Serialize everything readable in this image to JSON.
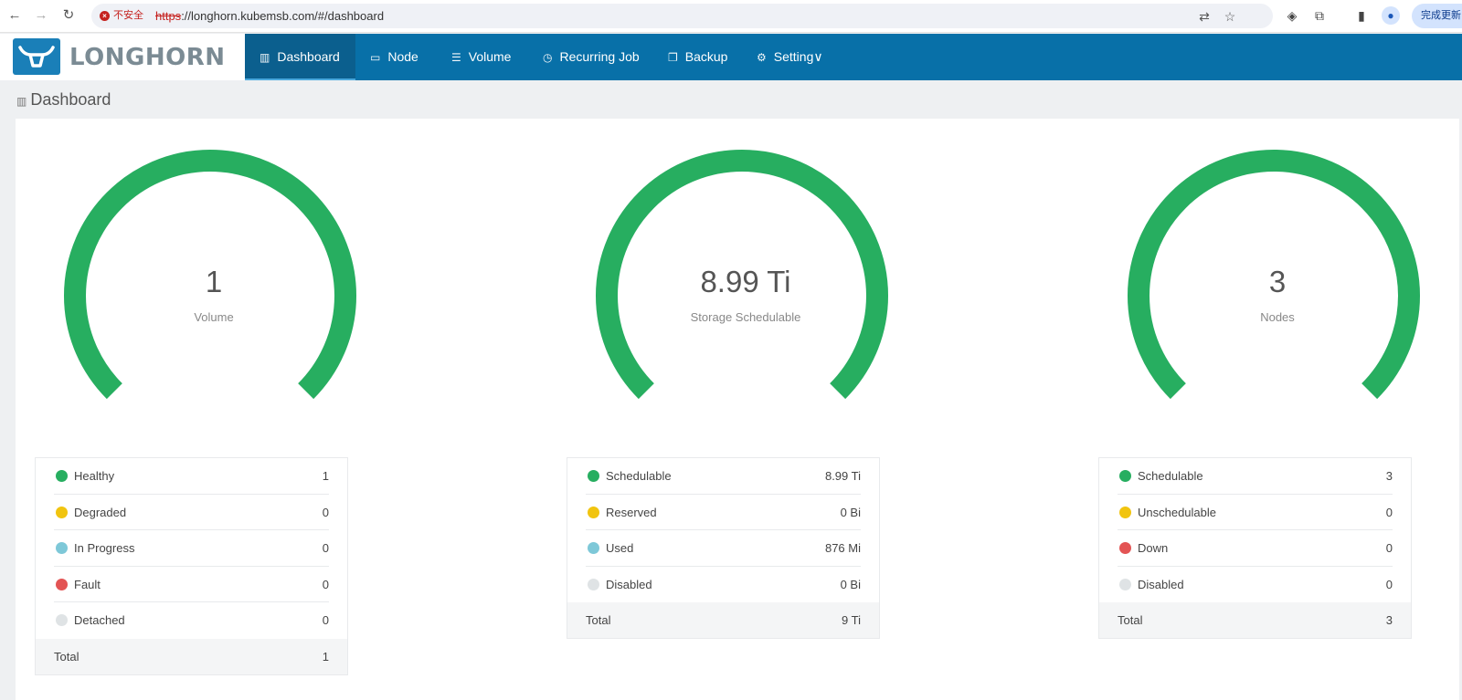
{
  "browser": {
    "back_icon": "arrow-left-icon",
    "forward_icon": "arrow-right-icon",
    "reload_icon": "reload-icon",
    "security_label": "不安全",
    "url_scheme": "https",
    "url_rest": "://longhorn.kubemsb.com/#/dashboard",
    "update_label": "完成更新"
  },
  "header": {
    "brand": "LONGHORN",
    "nav": [
      {
        "label": "Dashboard",
        "icon": "bar-chart-icon",
        "active": true
      },
      {
        "label": "Node",
        "icon": "laptop-icon"
      },
      {
        "label": "Volume",
        "icon": "database-icon"
      },
      {
        "label": "Recurring Job",
        "icon": "clock-icon"
      },
      {
        "label": "Backup",
        "icon": "copy-icon"
      },
      {
        "label": "Setting∨",
        "icon": "gear-icon"
      }
    ]
  },
  "page": {
    "title": "Dashboard"
  },
  "colors": {
    "green": "#27ae60",
    "yellow": "#f1c40f",
    "teal": "#7ec8d8",
    "red": "#e35454",
    "gray": "#dfe3e5",
    "header_blue": "#0870a8"
  },
  "panels": [
    {
      "value": "1",
      "label": "Volume",
      "gauge_fraction": 1.0,
      "rows": [
        {
          "label": "Healthy",
          "value": "1",
          "color": "#27ae60"
        },
        {
          "label": "Degraded",
          "value": "0",
          "color": "#f1c40f"
        },
        {
          "label": "In Progress",
          "value": "0",
          "color": "#7ec8d8"
        },
        {
          "label": "Fault",
          "value": "0",
          "color": "#e35454"
        },
        {
          "label": "Detached",
          "value": "0",
          "color": "#dfe3e5"
        }
      ],
      "total_label": "Total",
      "total_value": "1"
    },
    {
      "value": "8.99 Ti",
      "label": "Storage Schedulable",
      "gauge_fraction": 1.0,
      "rows": [
        {
          "label": "Schedulable",
          "value": "8.99 Ti",
          "color": "#27ae60"
        },
        {
          "label": "Reserved",
          "value": "0 Bi",
          "color": "#f1c40f"
        },
        {
          "label": "Used",
          "value": "876 Mi",
          "color": "#7ec8d8"
        },
        {
          "label": "Disabled",
          "value": "0 Bi",
          "color": "#dfe3e5"
        }
      ],
      "total_label": "Total",
      "total_value": "9 Ti"
    },
    {
      "value": "3",
      "label": "Nodes",
      "gauge_fraction": 1.0,
      "rows": [
        {
          "label": "Schedulable",
          "value": "3",
          "color": "#27ae60"
        },
        {
          "label": "Unschedulable",
          "value": "0",
          "color": "#f1c40f"
        },
        {
          "label": "Down",
          "value": "0",
          "color": "#e35454"
        },
        {
          "label": "Disabled",
          "value": "0",
          "color": "#dfe3e5"
        }
      ],
      "total_label": "Total",
      "total_value": "3"
    }
  ]
}
